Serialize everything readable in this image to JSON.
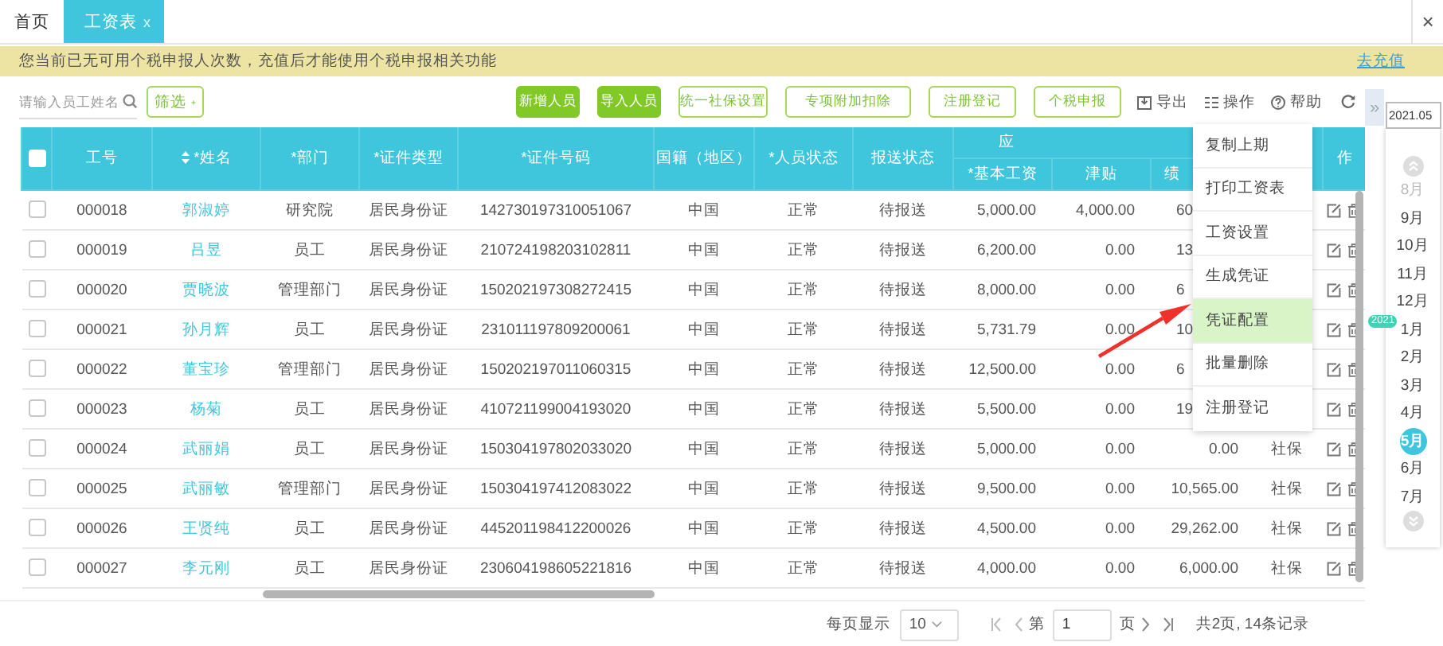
{
  "tabs": [
    {
      "label": "首页",
      "selected": false
    },
    {
      "label": "工资表",
      "selected": true,
      "close": "x"
    }
  ],
  "window_close": "×",
  "notice": {
    "text": "您当前已无可用个税申报人次数，充值后才能使用个税申报相关功能",
    "link": "去充值"
  },
  "toolbar": {
    "search": {
      "placeholder": "请输入员工姓名"
    },
    "filter": {
      "label": "筛选"
    },
    "buttons": [
      {
        "label": "新增人员",
        "kind": "primary"
      },
      {
        "label": "导入人员",
        "kind": "primary"
      },
      {
        "label": "统一社保设置",
        "kind": "outline"
      },
      {
        "label": "专项附加扣除",
        "kind": "outline"
      },
      {
        "label": "注册登记",
        "kind": "outline"
      },
      {
        "label": "个税申报",
        "kind": "outline"
      }
    ],
    "tools": [
      {
        "label": "导出",
        "kind": "export"
      },
      {
        "label": "操作",
        "kind": "operate"
      },
      {
        "label": "帮助",
        "kind": "help"
      },
      {
        "kind": "refresh"
      }
    ]
  },
  "table": {
    "all_checked": false,
    "columns": [
      {
        "label": "工号",
        "sortable": false
      },
      {
        "label": "*姓名",
        "sortable": true
      },
      {
        "label": "*部门",
        "sortable": false
      },
      {
        "label": "*证件类型",
        "sortable": false
      },
      {
        "label": "*证件号码",
        "sortable": false
      },
      {
        "label": "国籍（地区）",
        "sortable": false
      },
      {
        "label": "*人员状态",
        "sortable": false
      },
      {
        "label": "报送状态",
        "sortable": false
      }
    ],
    "group": {
      "label": "应",
      "columns": [
        "*基本工资",
        "津贴",
        "绩"
      ]
    },
    "action_column": "作",
    "rows": [
      {
        "checked": false,
        "id": "000018",
        "name": "郭淑婷",
        "department": "研究院",
        "id_type": "居民身份证",
        "id_number": "142730197310051067",
        "nationality": "中国",
        "status": "正常",
        "report_status": "待报送",
        "base_salary": "5,000.00",
        "allowance": "4,000.00",
        "group_col_3_partial": "60"
      },
      {
        "checked": false,
        "id": "000019",
        "name": "吕昱",
        "department": "员工",
        "id_type": "居民身份证",
        "id_number": "210724198203102811",
        "nationality": "中国",
        "status": "正常",
        "report_status": "待报送",
        "base_salary": "6,200.00",
        "allowance": "0.00",
        "group_col_3_partial": "13"
      },
      {
        "checked": false,
        "id": "000020",
        "name": "贾晓波",
        "department": "管理部门",
        "id_type": "居民身份证",
        "id_number": "150202197308272415",
        "nationality": "中国",
        "status": "正常",
        "report_status": "待报送",
        "base_salary": "8,000.00",
        "allowance": "0.00",
        "group_col_3_partial": "6"
      },
      {
        "checked": false,
        "id": "000021",
        "name": "孙月辉",
        "department": "员工",
        "id_type": "居民身份证",
        "id_number": "231011197809200061",
        "nationality": "中国",
        "status": "正常",
        "report_status": "待报送",
        "base_salary": "5,731.79",
        "allowance": "0.00",
        "group_col_3_partial": "10"
      },
      {
        "checked": false,
        "id": "000022",
        "name": "董宝珍",
        "department": "管理部门",
        "id_type": "居民身份证",
        "id_number": "150202197011060315",
        "nationality": "中国",
        "status": "正常",
        "report_status": "待报送",
        "base_salary": "12,500.00",
        "allowance": "0.00",
        "group_col_3_partial": "6"
      },
      {
        "checked": false,
        "id": "000023",
        "name": "杨菊",
        "department": "员工",
        "id_type": "居民身份证",
        "id_number": "410721199004193020",
        "nationality": "中国",
        "status": "正常",
        "report_status": "待报送",
        "base_salary": "5,500.00",
        "allowance": "0.00",
        "group_col_3_partial": "19"
      },
      {
        "checked": false,
        "id": "000024",
        "name": "武丽娟",
        "department": "员工",
        "id_type": "居民身份证",
        "id_number": "150304197802033020",
        "nationality": "中国",
        "status": "正常",
        "report_status": "待报送",
        "base_salary": "5,000.00",
        "allowance": "0.00",
        "group_col_3": "0.00",
        "social_insurance": "社保"
      },
      {
        "checked": false,
        "id": "000025",
        "name": "武丽敏",
        "department": "管理部门",
        "id_type": "居民身份证",
        "id_number": "150304197412083022",
        "nationality": "中国",
        "status": "正常",
        "report_status": "待报送",
        "base_salary": "9,500.00",
        "allowance": "0.00",
        "group_col_3": "10,565.00",
        "social_insurance": "社保"
      },
      {
        "checked": false,
        "id": "000026",
        "name": "王贤纯",
        "department": "员工",
        "id_type": "居民身份证",
        "id_number": "445201198412200026",
        "nationality": "中国",
        "status": "正常",
        "report_status": "待报送",
        "base_salary": "4,500.00",
        "allowance": "0.00",
        "group_col_3": "29,262.00",
        "social_insurance": "社保"
      },
      {
        "checked": false,
        "id": "000027",
        "name": "李元刚",
        "department": "员工",
        "id_type": "居民身份证",
        "id_number": "230604198605221816",
        "nationality": "中国",
        "status": "正常",
        "report_status": "待报送",
        "base_salary": "4,000.00",
        "allowance": "0.00",
        "group_col_3": "6,000.00",
        "social_insurance": "社保"
      }
    ]
  },
  "menu": {
    "items": [
      {
        "label": "复制上期",
        "selected": false
      },
      {
        "label": "打印工资表",
        "selected": false
      },
      {
        "label": "工资设置",
        "selected": false
      },
      {
        "label": "生成凭证",
        "selected": false
      },
      {
        "label": "凭证配置",
        "selected": true
      },
      {
        "label": "批量删除",
        "selected": false
      },
      {
        "label": "注册登记",
        "selected": false
      }
    ]
  },
  "month_picker": {
    "toggle": "»",
    "date": "2021.05",
    "months": [
      {
        "label": "8月",
        "selected": false,
        "disabled": true
      },
      {
        "label": "9月",
        "selected": false,
        "disabled": false
      },
      {
        "label": "10月",
        "selected": false,
        "disabled": false
      },
      {
        "label": "11月",
        "selected": false,
        "disabled": false
      },
      {
        "label": "12月",
        "selected": false,
        "disabled": false
      },
      {
        "label": "1月",
        "selected": false,
        "disabled": false,
        "year_badge": "2021"
      },
      {
        "label": "2月",
        "selected": false,
        "disabled": false
      },
      {
        "label": "3月",
        "selected": false,
        "disabled": false
      },
      {
        "label": "4月",
        "selected": false,
        "disabled": false
      },
      {
        "label": "5月",
        "selected": true,
        "disabled": false
      },
      {
        "label": "6月",
        "selected": false,
        "disabled": false
      },
      {
        "label": "7月",
        "selected": false,
        "disabled": false
      }
    ]
  },
  "pager": {
    "page_size_label": "每页显示",
    "page_size": "10",
    "page_prefix": "第",
    "page": "1",
    "page_suffix": "页",
    "summary": "共2页, 14条记录"
  }
}
